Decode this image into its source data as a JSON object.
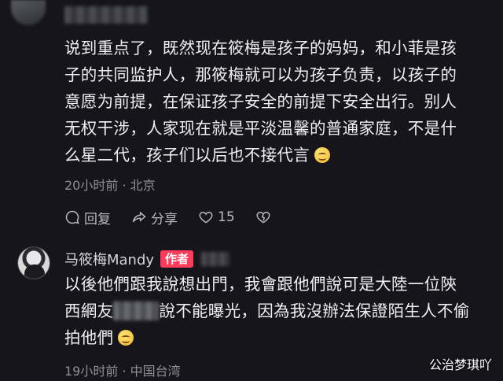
{
  "comment1": {
    "lines": [
      "说到重点了，既然现在筱梅是孩子的妈妈，和小菲是孩",
      "子的共同监护人，那筱梅就可以为孩子负责，以孩子的",
      "意愿为前提，在保证孩子安全的前提下安全出行。别人",
      "无权干涉，人家现在就是平淡温馨的普通家庭，不是什",
      "么星二代，孩子们以后也不接代言"
    ],
    "meta": "20小时前 · 北京",
    "actions": {
      "reply": "回复",
      "share": "分享",
      "likes": "15"
    }
  },
  "comment2": {
    "author": "马筱梅Mandy",
    "badge": "作者",
    "line1": "以後他們跟我說想出門，我會跟他們說可是大陸一位陝",
    "line2a": "西網友",
    "line2b": "說不能曝光，因為我沒辦法保證陌生人不偷",
    "line3": "拍他們",
    "meta": "19小时前 · 中国台湾"
  },
  "watermark": "公治梦琪吖",
  "icons": [
    "reply-icon",
    "share-icon",
    "heart-icon",
    "dislike-icon",
    "smile-emoji-icon"
  ]
}
